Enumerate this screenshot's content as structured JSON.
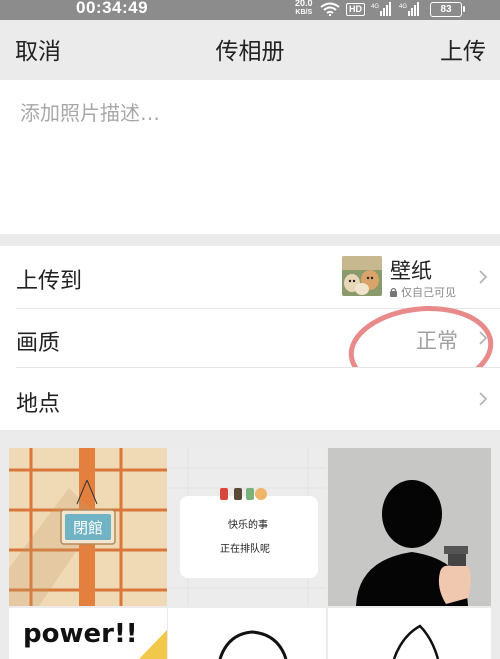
{
  "status_bar": {
    "time": "00:34:49",
    "net_speed_value": "20.0",
    "net_speed_unit": "KB/S",
    "hd_label": "HD",
    "battery": "83"
  },
  "nav": {
    "cancel_label": "取消",
    "title": "传相册",
    "upload_label": "上传"
  },
  "description": {
    "placeholder": "添加照片描述…"
  },
  "settings": {
    "upload_to": {
      "label": "上传到",
      "album_name": "壁纸",
      "privacy": "仅自己可见"
    },
    "quality": {
      "label": "画质",
      "value": "正常"
    },
    "location": {
      "label": "地点"
    }
  },
  "photos": [
    {
      "name": "photo-window-sign",
      "sign_text": "閉館"
    },
    {
      "name": "photo-happy-note",
      "note_line1": "快乐的事",
      "note_line2": "正在排队呢"
    },
    {
      "name": "photo-silhouette-gun"
    },
    {
      "name": "photo-power-sticker",
      "caption": "power!!"
    },
    {
      "name": "photo-doodle-face"
    },
    {
      "name": "photo-doodle-shape"
    }
  ],
  "colors": {
    "nav_bg": "#ebebeb",
    "status_bg": "#8c8c8c",
    "annotation": "#e88a8a"
  }
}
